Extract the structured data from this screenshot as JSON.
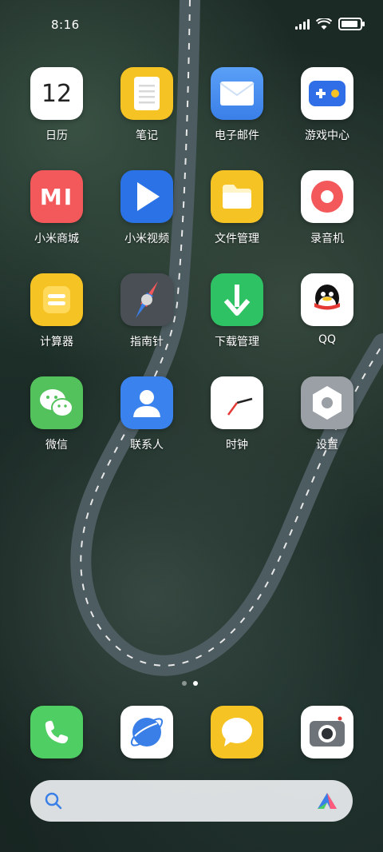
{
  "status_bar": {
    "time": "8:16"
  },
  "apps": [
    {
      "label": "日历",
      "icon": "calendar-icon",
      "text": "12"
    },
    {
      "label": "笔记",
      "icon": "notes-icon"
    },
    {
      "label": "电子邮件",
      "icon": "mail-icon"
    },
    {
      "label": "游戏中心",
      "icon": "game-center-icon"
    },
    {
      "label": "小米商城",
      "icon": "mi-store-icon",
      "text": "MI"
    },
    {
      "label": "小米视频",
      "icon": "video-icon"
    },
    {
      "label": "文件管理",
      "icon": "file-manager-icon"
    },
    {
      "label": "录音机",
      "icon": "recorder-icon"
    },
    {
      "label": "计算器",
      "icon": "calculator-icon"
    },
    {
      "label": "指南针",
      "icon": "compass-icon"
    },
    {
      "label": "下载管理",
      "icon": "download-icon"
    },
    {
      "label": "QQ",
      "icon": "qq-icon"
    },
    {
      "label": "微信",
      "icon": "wechat-icon"
    },
    {
      "label": "联系人",
      "icon": "contacts-icon"
    },
    {
      "label": "时钟",
      "icon": "clock-icon"
    },
    {
      "label": "设置",
      "icon": "settings-icon"
    }
  ],
  "dock": [
    {
      "icon": "phone-icon"
    },
    {
      "icon": "browser-icon"
    },
    {
      "icon": "messages-icon"
    },
    {
      "icon": "camera-icon"
    }
  ],
  "pages": {
    "count": 2,
    "active": 2
  },
  "search": {
    "icon": "search-icon",
    "brand_icon": "xiaoai-icon"
  }
}
